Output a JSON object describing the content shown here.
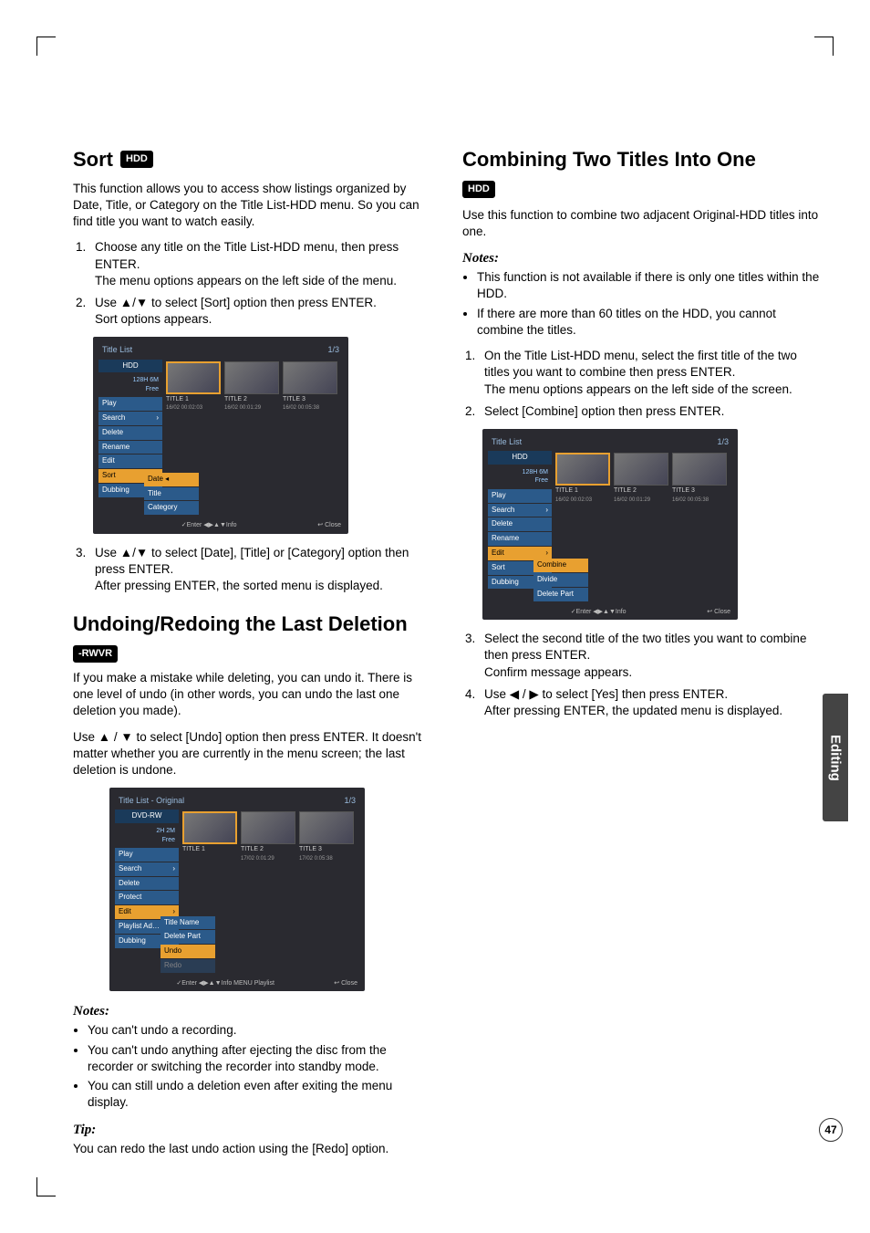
{
  "section_tab": "Editing",
  "page_number": "47",
  "left": {
    "h_sort": "Sort",
    "badge_hdd": "HDD",
    "sort_p1": "This function allows you to access show listings organized by Date, Title, or Category on the Title List-HDD menu. So you can find title you want to watch easily.",
    "sort_li1a": "Choose any title on the Title List-HDD menu, then press ENTER.",
    "sort_li1b": "The menu options appears on the left side of the menu.",
    "sort_li2a": "Use ▲/▼ to select [Sort] option then press ENTER.",
    "sort_li2b": "Sort options appears.",
    "sort_li3a": "Use ▲/▼ to select [Date], [Title] or [Category] option then press ENTER.",
    "sort_li3b": "After pressing ENTER, the sorted menu is displayed.",
    "h_undo": "Undoing/Redoing the Last Deletion",
    "badge_rwvr": "-RWVR",
    "undo_p1": "If you make a mistake while deleting, you can undo it. There is one level of undo (in other words, you can undo the last one deletion you made).",
    "undo_p2": "Use ▲ / ▼ to select [Undo] option then press ENTER. It doesn't matter whether you are currently in the menu screen; the last deletion is undone.",
    "notes_h": "Notes:",
    "note1": "You can't undo a recording.",
    "note2": "You can't undo anything after ejecting the disc from the recorder or switching the recorder into standby mode.",
    "note3": "You can still undo a deletion even after exiting the menu display.",
    "tip_h": "Tip:",
    "tip_p": "You can redo the last undo action using the [Redo] option."
  },
  "right": {
    "h_combine": "Combining Two Titles Into One",
    "badge_hdd": "HDD",
    "comb_p1": "Use this function to combine two adjacent Original-HDD titles into one.",
    "notes_h": "Notes:",
    "note1": "This function is not available if there is only one titles within the HDD.",
    "note2": "If there are more than 60 titles on the HDD, you cannot combine the titles.",
    "li1a": "On the Title List-HDD menu, select the first title of the two titles you want to combine then press ENTER.",
    "li1b": "The menu options appears on the left side of the screen.",
    "li2": "Select [Combine] option then press ENTER.",
    "li3a": "Select the second title of the two titles you want to combine then press ENTER.",
    "li3b": "Confirm message appears.",
    "li4a": "Use ◀ / ▶ to select [Yes] then press ENTER.",
    "li4b": "After pressing ENTER, the updated menu is displayed."
  },
  "mock1": {
    "title": "Title List",
    "page": "1/3",
    "hdr": "HDD",
    "free": "128H 6M\nFree",
    "menu": [
      "Play",
      "Search",
      "Delete",
      "Rename",
      "Edit",
      "Sort",
      "Dubbing"
    ],
    "submenu": [
      "Date",
      "Title",
      "Category"
    ],
    "thumbs": [
      {
        "t": "TITLE 1",
        "d": "16/02  00:02:03"
      },
      {
        "t": "TITLE 2",
        "d": "16/02  00:01:29"
      },
      {
        "t": "TITLE 3",
        "d": "16/02  00:05:38"
      }
    ],
    "footer_l": "✓Enter  ◀▶▲▼Info",
    "footer_r": "↩ Close"
  },
  "mock2": {
    "title": "Title List - Original",
    "page": "1/3",
    "hdr": "DVD-RW",
    "free": "2H 2M\nFree",
    "menu": [
      "Play",
      "Search",
      "Delete",
      "Protect",
      "Edit",
      "Playlist Ad…",
      "Dubbing"
    ],
    "submenu": [
      "Title Name",
      "Delete Part",
      "Undo",
      "Redo"
    ],
    "thumbs": [
      {
        "t": "TITLE 1",
        "d": ""
      },
      {
        "t": "TITLE 2",
        "d": "17/02  0:01:29"
      },
      {
        "t": "TITLE 3",
        "d": "17/02  0:05:38"
      }
    ],
    "footer_l": "✓Enter  ◀▶▲▼Info  MENU Playlist",
    "footer_r": "↩ Close"
  },
  "mock3": {
    "title": "Title List",
    "page": "1/3",
    "hdr": "HDD",
    "free": "128H 6M\nFree",
    "menu": [
      "Play",
      "Search",
      "Delete",
      "Rename",
      "Edit",
      "Sort",
      "Dubbing"
    ],
    "submenu": [
      "Combine",
      "Divide",
      "Delete Part"
    ],
    "thumbs": [
      {
        "t": "TITLE 1",
        "d": "16/02  00:02:03"
      },
      {
        "t": "TITLE 2",
        "d": "16/02  00:01:29"
      },
      {
        "t": "TITLE 3",
        "d": "16/02  00:05:38"
      }
    ],
    "footer_l": "✓Enter  ◀▶▲▼Info",
    "footer_r": "↩ Close"
  }
}
